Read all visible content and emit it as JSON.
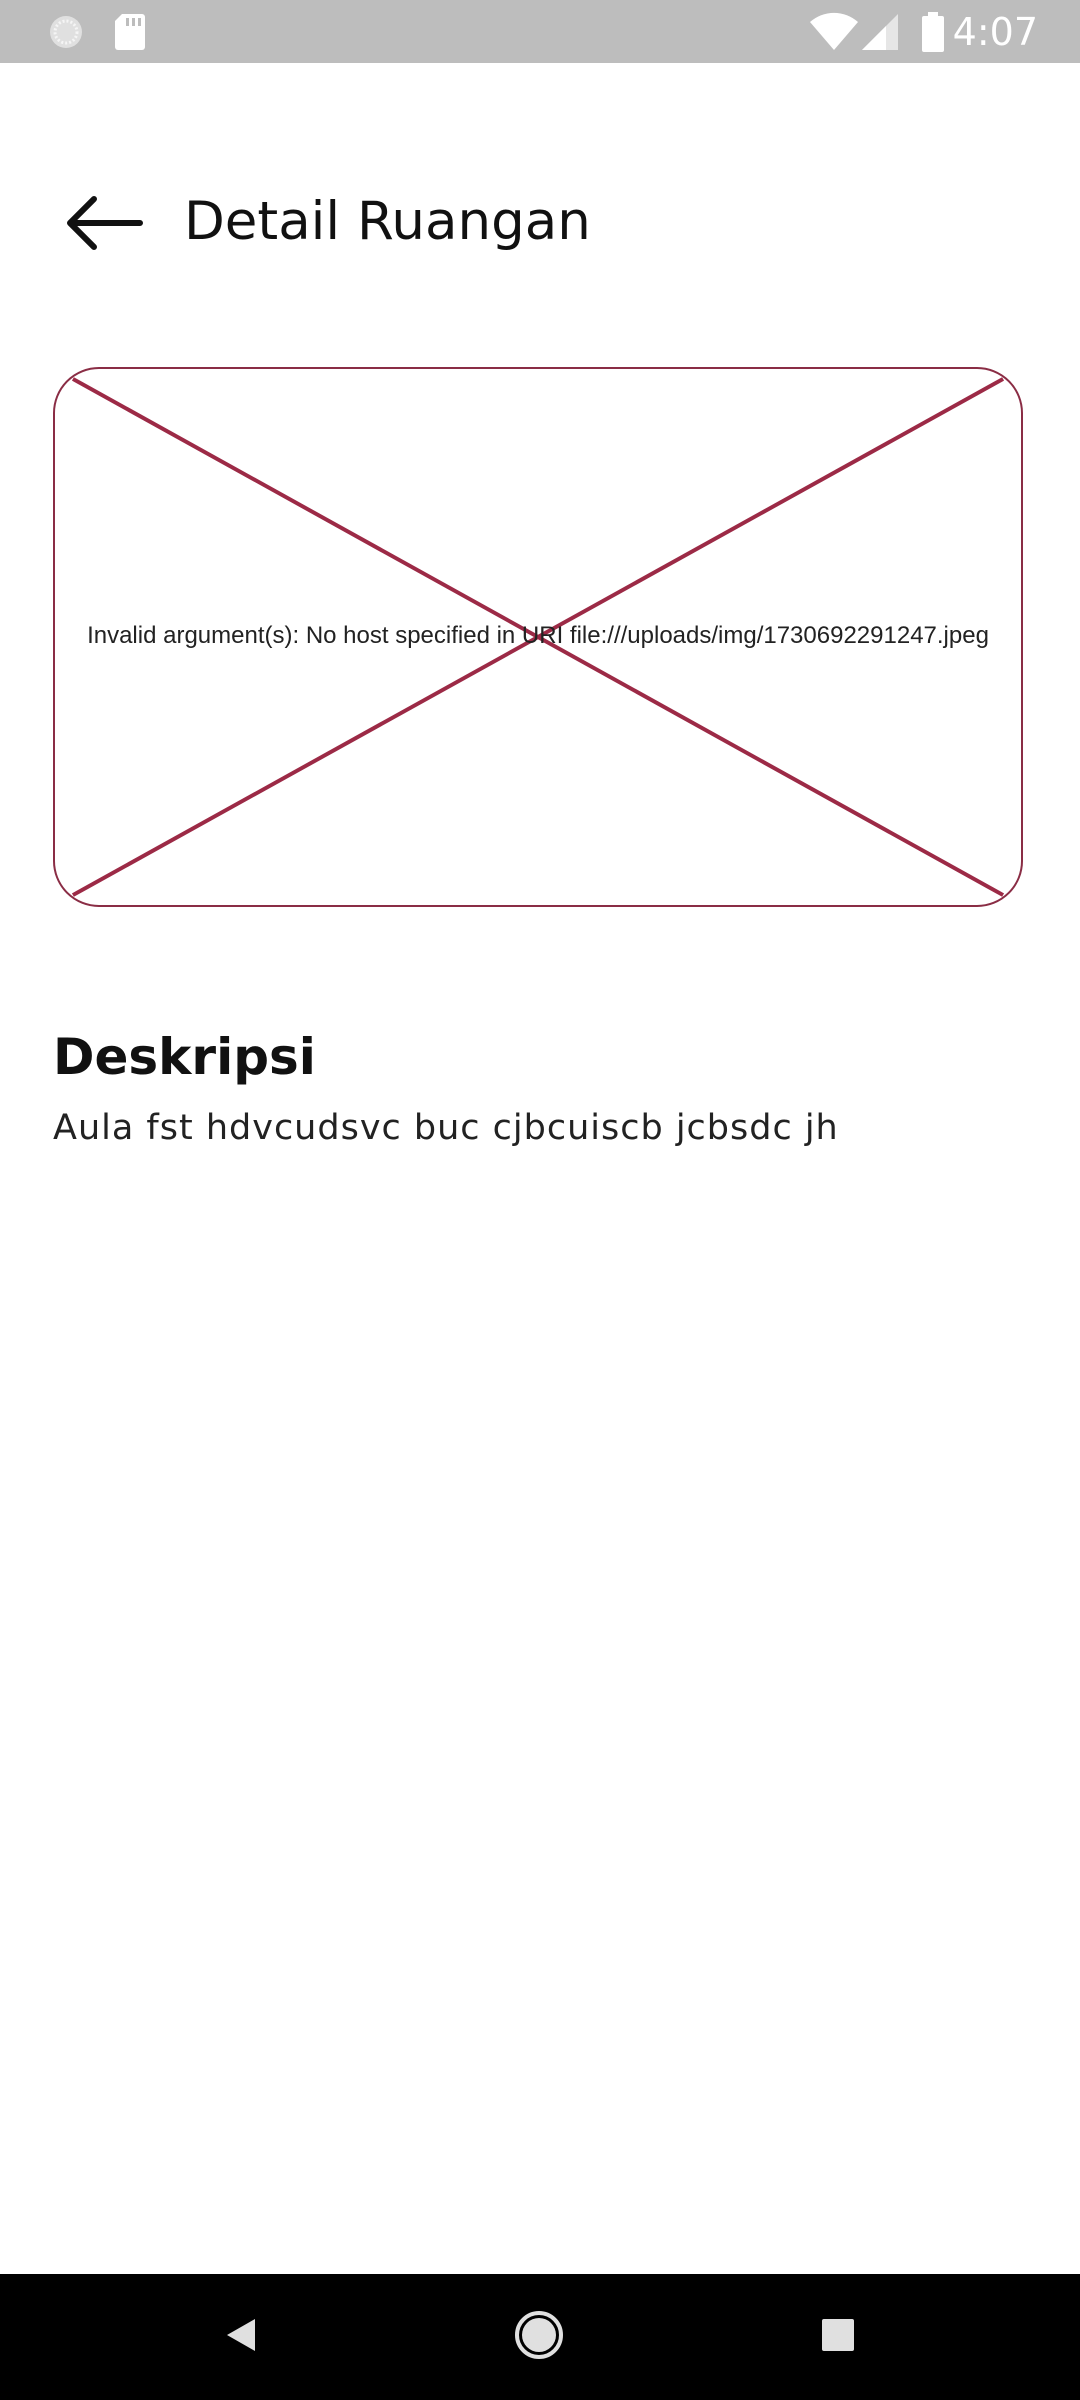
{
  "status_bar": {
    "time": "4:07",
    "icons": [
      "notification-circle-icon",
      "sd-card-icon",
      "wifi-icon",
      "cellular-signal-icon",
      "battery-icon"
    ]
  },
  "app_bar": {
    "back_icon": "arrow-back-icon",
    "title": "Detail Ruangan"
  },
  "image": {
    "error_message": "Invalid argument(s): No host specified in URI file:///uploads/img/1730692291247.jpeg",
    "border_color": "#8a2d45"
  },
  "description": {
    "heading": "Deskripsi",
    "text": "Aula fst hdvcudsvc buc cjbcuiscb jcbsdc jh"
  },
  "nav_bar": {
    "buttons": [
      "back-triangle-icon",
      "home-circle-icon",
      "recents-square-icon"
    ]
  }
}
